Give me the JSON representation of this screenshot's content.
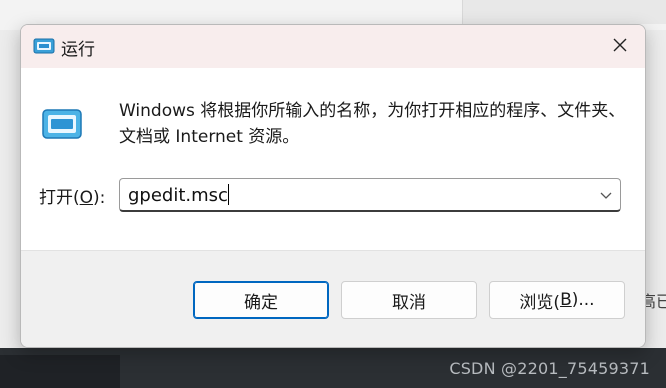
{
  "dialog": {
    "title": "运行",
    "description": "Windows 将根据你所输入的名称，为你打开相应的程序、文件夹、文档或 Internet 资源。",
    "open_label_prefix": "打开(",
    "open_label_key": "O",
    "open_label_suffix": "):",
    "input_value": "gpedit.msc",
    "buttons": {
      "ok": "确定",
      "cancel": "取消",
      "browse_prefix": "浏览(",
      "browse_key": "B",
      "browse_suffix": ")..."
    }
  },
  "background": {
    "side_text": "高已",
    "watermark": "CSDN @2201_75459371"
  },
  "colors": {
    "titlebar": "#f8eded",
    "accent": "#0067c0",
    "footer": "#f0f0f0"
  },
  "icons": {
    "title": "run-icon",
    "content": "run-icon",
    "close": "close-icon",
    "dropdown": "chevron-down-icon"
  }
}
